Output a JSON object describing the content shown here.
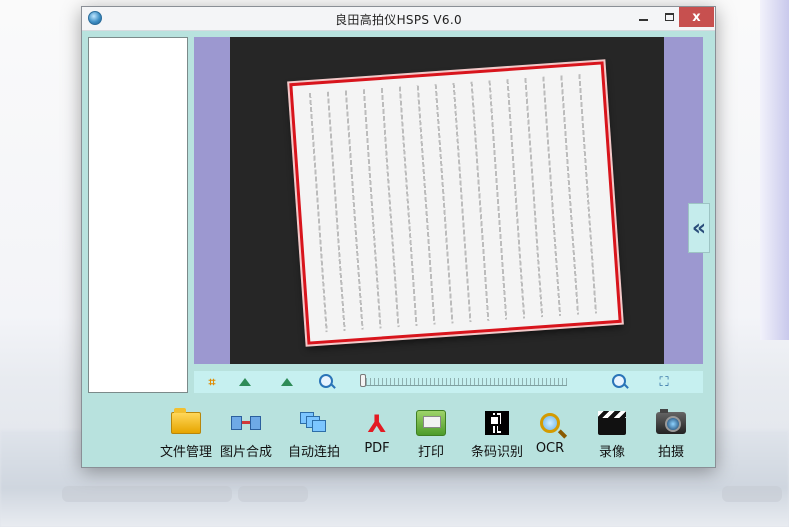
{
  "window": {
    "title": "良田高拍仪HSPS V6.0",
    "controls": {
      "minimize_icon": "minimize-icon",
      "maximize_icon": "maximize-icon",
      "close_label": "x"
    },
    "app_icon": "app-globe-icon"
  },
  "preview": {
    "collapse_label": "«",
    "doc_border_color": "#d8141c",
    "background_color": "#9c98d0"
  },
  "view_toolbar": {
    "icons": [
      "crop-icon",
      "rotate-left-icon",
      "rotate-right-icon",
      "zoom-out-icon",
      "zoom-slider",
      "zoom-in-icon",
      "fit-window-icon"
    ],
    "zoom_level": 0
  },
  "function_bar": {
    "buttons": [
      {
        "label": "文件管理",
        "icon": "folder-icon"
      },
      {
        "label": "图片合成",
        "icon": "image-merge-icon"
      },
      {
        "label": "自动连拍",
        "icon": "auto-burst-icon"
      },
      {
        "label": "PDF",
        "icon": "pdf-icon"
      },
      {
        "label": "打印",
        "icon": "printer-icon"
      },
      {
        "label": "条码识别",
        "icon": "qr-code-icon"
      },
      {
        "label": "OCR",
        "icon": "ocr-magnifier-icon"
      },
      {
        "label": "录像",
        "icon": "video-clapper-icon"
      },
      {
        "label": "拍摄",
        "icon": "camera-icon"
      }
    ]
  },
  "colors": {
    "client_bg": "#b8e2de",
    "toolbar_strip": "#c6f0f0",
    "close_button": "#c7504f"
  }
}
